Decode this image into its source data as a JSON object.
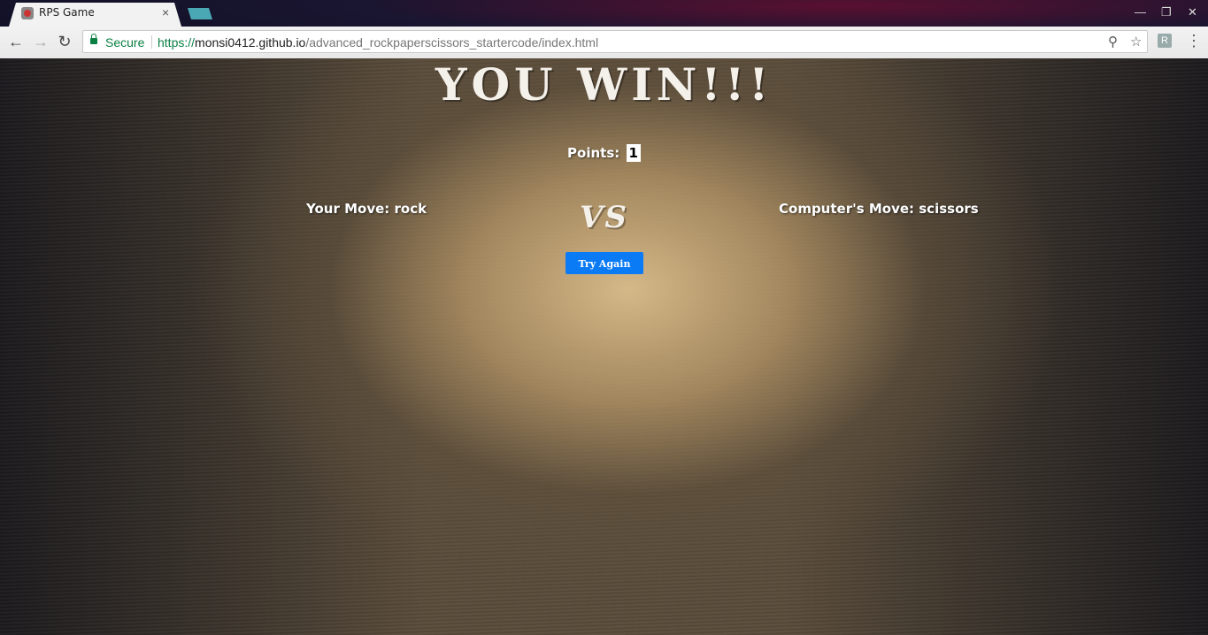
{
  "browser": {
    "tab_title": "RPS Game",
    "tab_close": "×",
    "secure_label": "Secure",
    "url_scheme": "https://",
    "url_host": "monsi0412.github.io",
    "url_path": "/advanced_rockpaperscissors_startercode/index.html",
    "back_icon": "←",
    "forward_icon": "→",
    "reload_icon": "↻",
    "zoom_icon": "⚲",
    "star_icon": "☆",
    "extension_icon": "R",
    "menu_icon": "⋮",
    "minimize_icon": "—",
    "restore_icon": "❐",
    "close_icon": "✕"
  },
  "game": {
    "result_title": "YOU WIN!!!",
    "points_label": "Points:",
    "points_value": "1",
    "player_move": "Your Move: rock",
    "vs_label": "VS",
    "computer_move": "Computer's Move: scissors",
    "try_again_label": "Try Again"
  },
  "colors": {
    "button": "#0b7bf5",
    "secure": "#0b8043"
  }
}
